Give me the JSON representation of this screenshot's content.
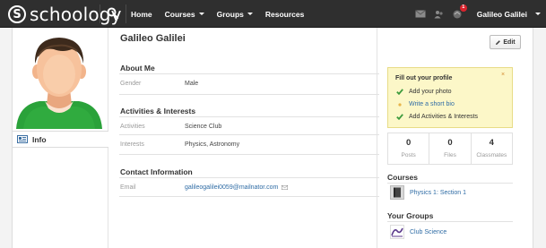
{
  "brand": {
    "logo_s": "S",
    "logo_text": "schoology"
  },
  "nav": {
    "home": "Home",
    "courses": "Courses",
    "groups": "Groups",
    "resources": "Resources",
    "notification_count": "1",
    "user_name": "Galileo Galilei"
  },
  "profile": {
    "name": "Galileo Galilei",
    "edit_label": "Edit",
    "info_tab": "Info"
  },
  "about": {
    "title": "About Me",
    "gender_label": "Gender",
    "gender_value": "Male"
  },
  "activities": {
    "title": "Activities & Interests",
    "activities_label": "Activities",
    "activities_value": "Science Club",
    "interests_label": "Interests",
    "interests_value": "Physics, Astronomy"
  },
  "contact": {
    "title": "Contact Information",
    "email_label": "Email",
    "email_value": "galileogalilei0059@mailnator.com"
  },
  "todo": {
    "title": "Fill out your profile",
    "close": "×",
    "items": [
      {
        "label": "Add your photo",
        "done": true
      },
      {
        "label": "Write a short bio",
        "done": false
      },
      {
        "label": "Add Activities & Interests",
        "done": true
      }
    ]
  },
  "stats": [
    {
      "value": "0",
      "label": "Posts"
    },
    {
      "value": "0",
      "label": "Files"
    },
    {
      "value": "4",
      "label": "Classmates"
    }
  ],
  "courses": {
    "title": "Courses",
    "items": [
      {
        "label": "Physics 1: Section 1"
      }
    ]
  },
  "groups": {
    "title": "Your Groups",
    "items": [
      {
        "label": "Club Science"
      }
    ]
  },
  "colors": {
    "topbar": "#2f2f2f",
    "link": "#2f6ca5",
    "todo_bg": "#fcf7c8",
    "check": "#3c9a3c",
    "notification": "#d9232d"
  }
}
